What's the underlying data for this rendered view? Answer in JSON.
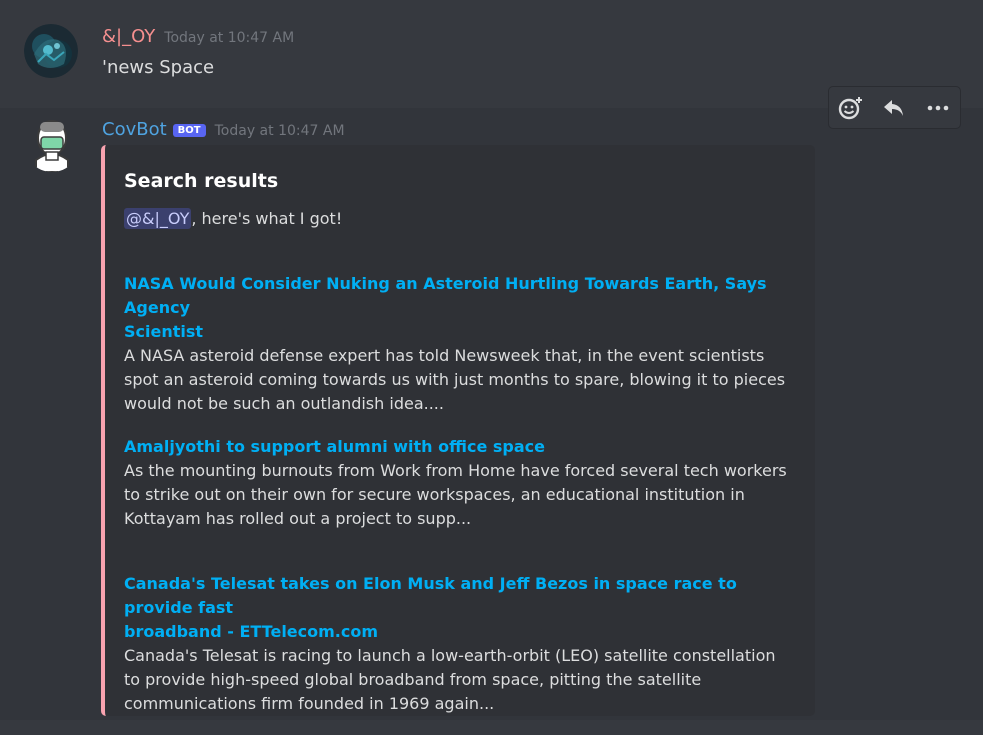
{
  "message1": {
    "username": "&|_OY",
    "timestamp": "Today at 10:47 AM",
    "content": "'news Space"
  },
  "message2": {
    "username": "CovBot",
    "badge": "BOT",
    "timestamp": "Today at 10:47 AM",
    "embed": {
      "title": "Search results",
      "mention": "@&|_OY",
      "description_suffix": ", here's what I got!",
      "accent_color": "#f8a3b0",
      "results": [
        {
          "title_lines": [
            "NASA Would Consider Nuking an Asteroid Hurtling Towards Earth, Says Agency",
            "Scientist"
          ],
          "text_lines": [
            "A NASA asteroid defense expert has told Newsweek that, in the event scientists",
            "spot an asteroid coming towards us with just months to spare, blowing it to pieces",
            "would not be such an outlandish idea...."
          ]
        },
        {
          "title_lines": [
            "Amaljyothi to support alumni with office space"
          ],
          "text_lines": [
            "As the mounting burnouts from Work from Home have forced several tech workers",
            "to strike out on their own for secure workspaces, an educational institution in",
            "Kottayam has rolled out a project to supp..."
          ]
        },
        {
          "title_lines": [
            "Canada's Telesat takes on Elon Musk and Jeff Bezos in space race to provide fast",
            "broadband - ETTelecom.com"
          ],
          "text_lines": [
            "Canada's Telesat is racing to launch a low-earth-orbit (LEO) satellite constellation",
            "to provide high-speed global broadband from space, pitting the satellite",
            "communications firm founded in 1969 again..."
          ]
        }
      ]
    }
  },
  "actions": {
    "add_reaction_icon": "add-reaction-icon",
    "reply_icon": "reply-icon",
    "more_icon": "more-icon"
  }
}
